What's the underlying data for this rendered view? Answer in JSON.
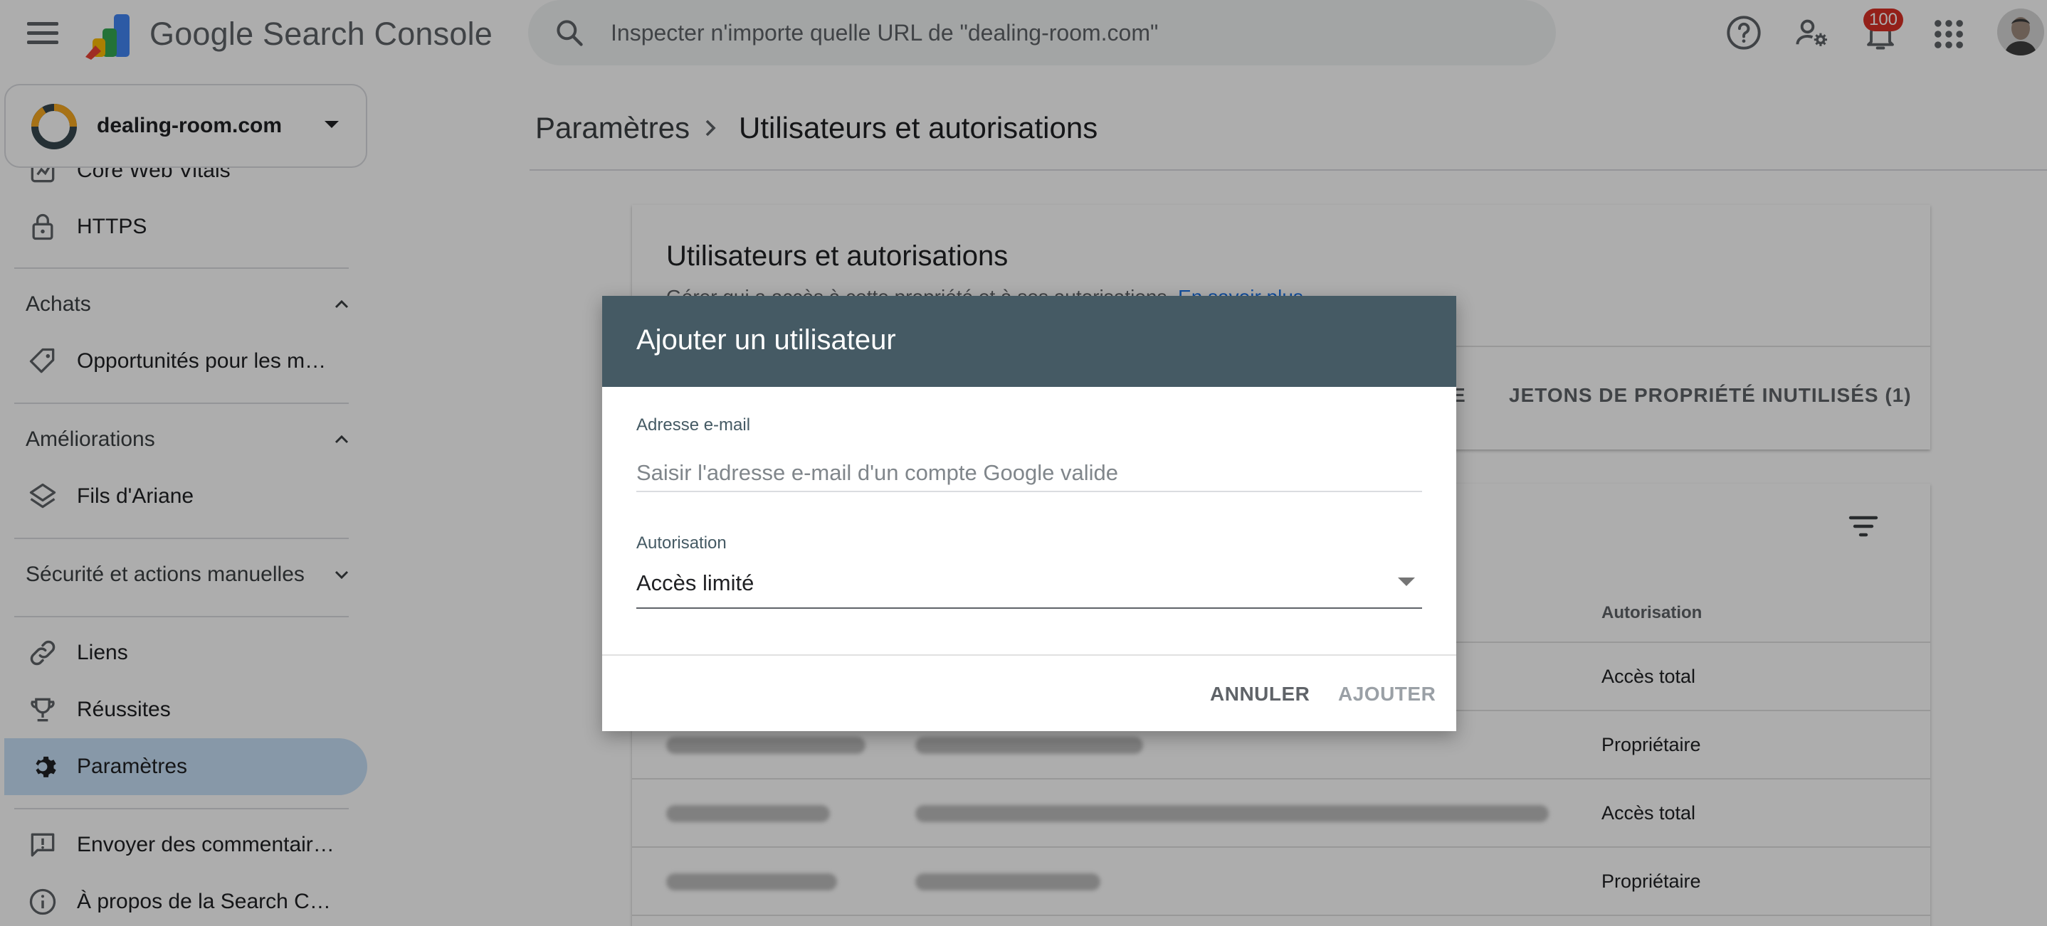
{
  "app": {
    "product_name": "Google Search Console"
  },
  "search": {
    "placeholder": "Inspecter n'importe quelle URL de \"dealing-room.com\""
  },
  "header": {
    "notification_count": "100"
  },
  "property": {
    "name": "dealing-room.com"
  },
  "sidebar": {
    "items": [
      {
        "label": "Core Web Vitals",
        "icon": "core-web-vitals-icon"
      },
      {
        "label": "HTTPS",
        "icon": "lock-icon"
      }
    ],
    "sections": [
      {
        "label": "Achats",
        "expanded": true,
        "items": [
          {
            "label": "Opportunités pour les m…",
            "icon": "tag-icon"
          }
        ]
      },
      {
        "label": "Améliorations",
        "expanded": true,
        "items": [
          {
            "label": "Fils d'Ariane",
            "icon": "layers-icon"
          }
        ]
      },
      {
        "label": "Sécurité et actions manuelles",
        "expanded": false,
        "items": []
      }
    ],
    "links": [
      {
        "label": "Liens",
        "icon": "link-icon"
      },
      {
        "label": "Réussites",
        "icon": "trophy-icon"
      },
      {
        "label": "Paramètres",
        "icon": "gear-icon",
        "active": true
      }
    ],
    "footer": [
      {
        "label": "Envoyer des commentair…",
        "icon": "feedback-icon"
      },
      {
        "label": "À propos de la Search C…",
        "icon": "info-icon"
      }
    ]
  },
  "breadcrumb": {
    "parent": "Paramètres",
    "current": "Utilisateurs et autorisations"
  },
  "card": {
    "title": "Utilisateurs et autorisations",
    "description": "Gérer qui a accès à cette propriété et à ses autorisations.",
    "link": "En savoir plus",
    "tab_fragment": "E",
    "tab_unused_tokens": "JETONS DE PROPRIÉTÉ INUTILISÉS (1)"
  },
  "table": {
    "permission_header": "Autorisation",
    "rows": [
      {
        "permission": "Accès total"
      },
      {
        "permission": "Propriétaire"
      },
      {
        "permission": "Accès total"
      },
      {
        "permission": "Propriétaire"
      }
    ]
  },
  "dialog": {
    "title": "Ajouter un utilisateur",
    "email_label": "Adresse e-mail",
    "email_placeholder": "Saisir l'adresse e-mail d'un compte Google valide",
    "email_value": "",
    "permission_label": "Autorisation",
    "permission_value": "Accès limité",
    "cancel_label": "ANNULER",
    "add_label": "AJOUTER"
  },
  "colors": {
    "dialog_header": "#455a64",
    "active_nav": "#c8e0f8",
    "badge": "#d93025",
    "link": "#1a73e8"
  }
}
